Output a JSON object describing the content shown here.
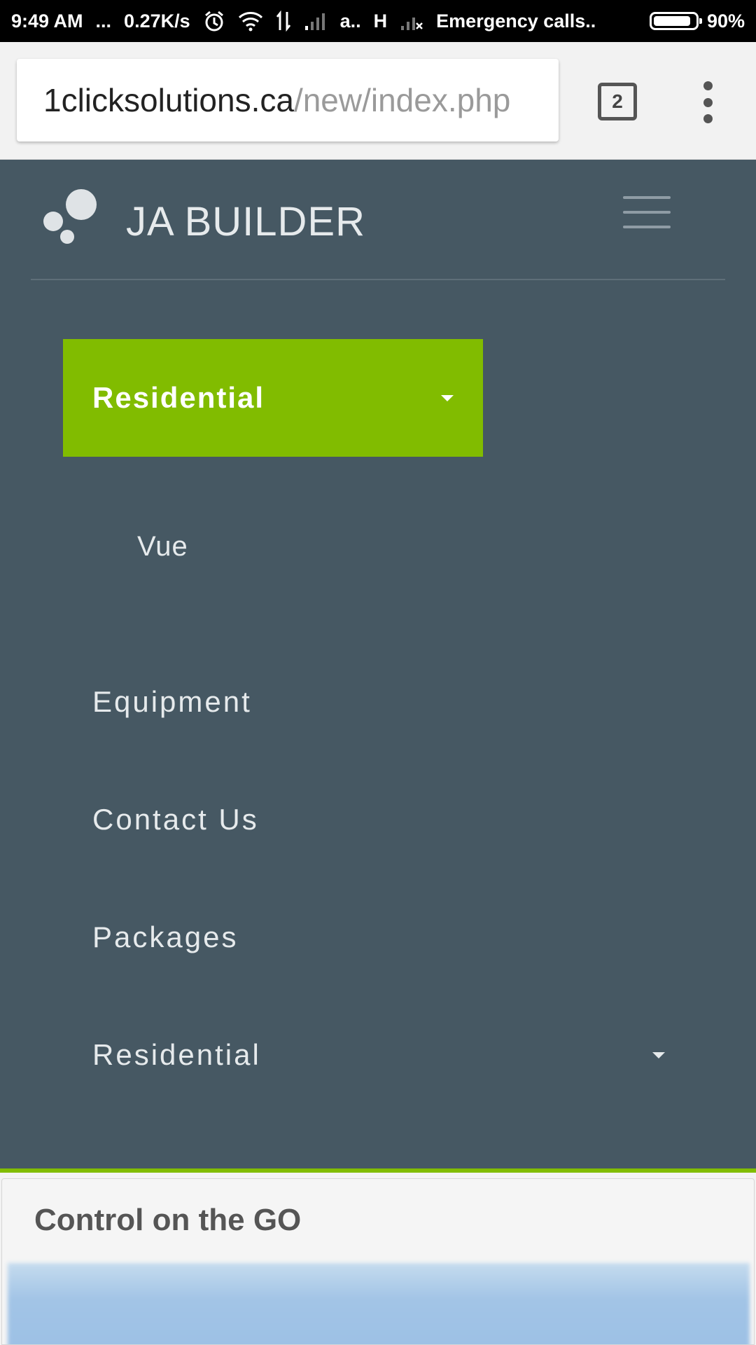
{
  "status_bar": {
    "time": "9:49 AM",
    "more": "...",
    "speed": "0.27K/s",
    "carrier1": "a..",
    "network_type": "H",
    "emergency": "Emergency calls..",
    "battery": "90%",
    "battery_level": 0.9
  },
  "browser": {
    "url_domain": "1clicksolutions.ca",
    "url_path": "/new/index.php",
    "tab_count": "2"
  },
  "site": {
    "brand": "JA BUILDER",
    "colors": {
      "nav_bg": "#465863",
      "accent": "#81bc00"
    },
    "active_item": "Residential",
    "sub_item": "Vue",
    "nav_items": [
      {
        "label": "Equipment",
        "has_dropdown": false
      },
      {
        "label": "Contact Us",
        "has_dropdown": false
      },
      {
        "label": "Packages",
        "has_dropdown": false
      },
      {
        "label": "Residential",
        "has_dropdown": true
      }
    ]
  },
  "content": {
    "card_title": "Control on the GO"
  }
}
